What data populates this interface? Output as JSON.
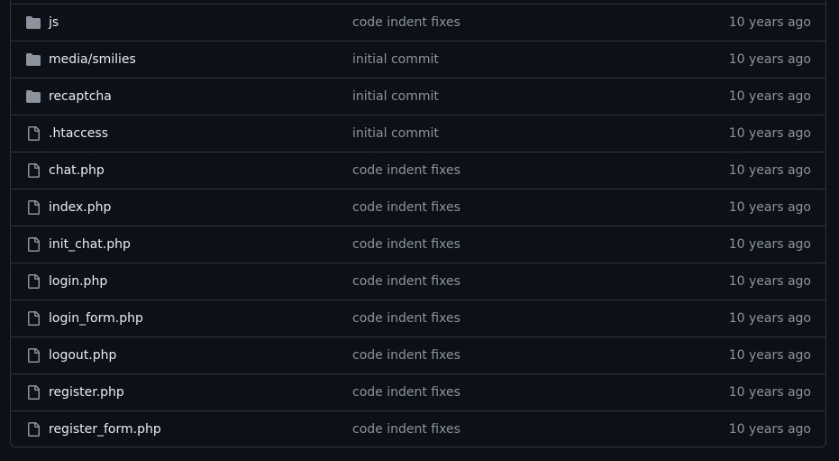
{
  "colors": {
    "background": "#0d1117",
    "border": "#30363d",
    "text": "#e6edf3",
    "muted": "#8b949e",
    "icon": "#8b949e"
  },
  "files": [
    {
      "type": "directory",
      "icon": "folder-icon",
      "name": "js",
      "commit": "code indent fixes",
      "age": "10 years ago"
    },
    {
      "type": "directory",
      "icon": "folder-icon",
      "name": "media/smilies",
      "commit": "initial commit",
      "age": "10 years ago"
    },
    {
      "type": "directory",
      "icon": "folder-icon",
      "name": "recaptcha",
      "commit": "initial commit",
      "age": "10 years ago"
    },
    {
      "type": "file",
      "icon": "file-icon",
      "name": ".htaccess",
      "commit": "initial commit",
      "age": "10 years ago"
    },
    {
      "type": "file",
      "icon": "file-icon",
      "name": "chat.php",
      "commit": "code indent fixes",
      "age": "10 years ago"
    },
    {
      "type": "file",
      "icon": "file-icon",
      "name": "index.php",
      "commit": "code indent fixes",
      "age": "10 years ago"
    },
    {
      "type": "file",
      "icon": "file-icon",
      "name": "init_chat.php",
      "commit": "code indent fixes",
      "age": "10 years ago"
    },
    {
      "type": "file",
      "icon": "file-icon",
      "name": "login.php",
      "commit": "code indent fixes",
      "age": "10 years ago"
    },
    {
      "type": "file",
      "icon": "file-icon",
      "name": "login_form.php",
      "commit": "code indent fixes",
      "age": "10 years ago"
    },
    {
      "type": "file",
      "icon": "file-icon",
      "name": "logout.php",
      "commit": "code indent fixes",
      "age": "10 years ago"
    },
    {
      "type": "file",
      "icon": "file-icon",
      "name": "register.php",
      "commit": "code indent fixes",
      "age": "10 years ago"
    },
    {
      "type": "file",
      "icon": "file-icon",
      "name": "register_form.php",
      "commit": "code indent fixes",
      "age": "10 years ago"
    }
  ]
}
